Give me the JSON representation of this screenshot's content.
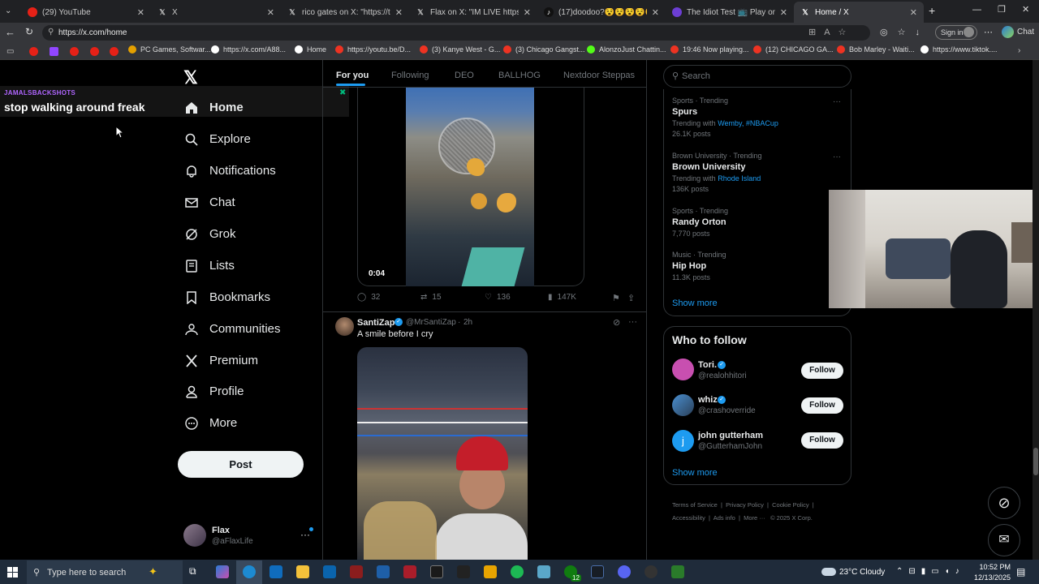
{
  "browser": {
    "tabs": [
      {
        "label": "(29) YouTube",
        "icon": "youtube-icon",
        "color": "#e62117"
      },
      {
        "label": "X",
        "icon": "x-icon",
        "color": "#fff"
      },
      {
        "label": "rico gates on X: \"https://t.co/wQ...",
        "icon": "x-icon",
        "color": "#fff"
      },
      {
        "label": "Flax on X: \"IM LIVE https://t.co/7G...",
        "icon": "x-icon",
        "color": "#fff"
      },
      {
        "label": "(17)doodoo?😵😵😵😵😵😵",
        "icon": "tiktok-icon",
        "color": "#fff"
      },
      {
        "label": "The Idiot Test 📺 Play on CrazyGa...",
        "icon": "crazygames-icon",
        "color": "#6c3ed4"
      },
      {
        "label": "Home / X",
        "icon": "x-icon",
        "color": "#fff"
      }
    ],
    "url": "https://x.com/home",
    "signin_label": "Sign in",
    "chat_label": "Chat",
    "bookmarks": [
      {
        "label": "PC Games, Softwar...",
        "color": "#e4a000"
      },
      {
        "label": "https://x.com/A88...",
        "color": "#fff"
      },
      {
        "label": "Home",
        "color": "#fff"
      },
      {
        "label": "https://youtu.be/D...",
        "color": "#e62117"
      },
      {
        "label": "(3) Kanye West - G...",
        "color": "#e62117"
      },
      {
        "label": "(3) Chicago Gangst...",
        "color": "#e62117"
      },
      {
        "label": "AlonzoJust Chattin...",
        "color": "#53fc18"
      },
      {
        "label": "19:46 Now playing...",
        "color": "#e62117"
      },
      {
        "label": "(12) CHICAGO GA...",
        "color": "#e62117"
      },
      {
        "label": "Bob Marley - Waiti...",
        "color": "#e62117"
      },
      {
        "label": "https://www.tiktok....",
        "color": "#fff"
      }
    ]
  },
  "overlay": {
    "username": "JAMALSBACKSHOTS",
    "message": "stop walking around freak"
  },
  "nav": {
    "items": [
      "Home",
      "Explore",
      "Notifications",
      "Chat",
      "Grok",
      "Lists",
      "Bookmarks",
      "Communities",
      "Premium",
      "Profile",
      "More"
    ],
    "post_label": "Post",
    "account": {
      "name": "Flax",
      "handle": "@aFlaxLife"
    }
  },
  "feed": {
    "tabs": [
      "For you",
      "Following",
      "DEO",
      "BALLHOG",
      "Nextdoor Steppas"
    ],
    "video_time": "0:04",
    "stats": {
      "replies": "32",
      "reposts": "15",
      "likes": "136",
      "views": "147K"
    },
    "post": {
      "author": "SantiZap",
      "handle": "@MrSantiZap",
      "time": "2h",
      "text": "A smile before I cry"
    }
  },
  "search": {
    "placeholder": "Search"
  },
  "trends": [
    {
      "category": "Sports · Trending",
      "name": "Spurs",
      "with_prefix": "Trending with",
      "with": "Wemby, #NBACup",
      "posts": "26.1K posts"
    },
    {
      "category": "Brown University · Trending",
      "name": "Brown University",
      "with_prefix": "Trending with",
      "with": "Rhode Island",
      "posts": "136K posts"
    },
    {
      "category": "Sports · Trending",
      "name": "Randy Orton",
      "with_prefix": "",
      "with": "",
      "posts": "7,770 posts"
    },
    {
      "category": "Music · Trending",
      "name": "Hip Hop",
      "with_prefix": "",
      "with": "",
      "posts": "11.3K posts"
    }
  ],
  "show_more": "Show more",
  "who_to_follow": {
    "title": "Who to follow",
    "users": [
      {
        "name": "Tori.",
        "handle": "@realohhitori",
        "color": "#c84fb0"
      },
      {
        "name": "whiz",
        "handle": "@crashoverride",
        "color": "#4a8fd0"
      },
      {
        "name": "john gutterham",
        "handle": "@GutterhamJohn",
        "color": "#1d9bf0"
      }
    ],
    "follow_label": "Follow",
    "show_more": "Show more"
  },
  "footer": {
    "links": [
      "Terms of Service",
      "Privacy Policy",
      "Cookie Policy",
      "Accessibility",
      "Ads info",
      "More ···",
      "© 2025 X Corp."
    ]
  },
  "taskbar": {
    "search_placeholder": "Type here to search",
    "weather": "23°C  Cloudy",
    "time": "10:52 PM",
    "date": "12/13/2025",
    "badge": "12"
  }
}
